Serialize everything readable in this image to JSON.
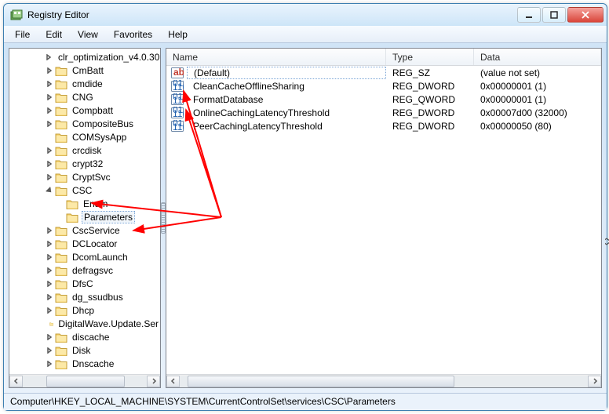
{
  "window": {
    "title": "Registry Editor"
  },
  "menu": {
    "file": "File",
    "edit": "Edit",
    "view": "View",
    "favorites": "Favorites",
    "help": "Help"
  },
  "tree": {
    "items": [
      {
        "label": "clr_optimization_v4.0.30",
        "depth": 3,
        "expandable": true
      },
      {
        "label": "CmBatt",
        "depth": 3,
        "expandable": true
      },
      {
        "label": "cmdide",
        "depth": 3,
        "expandable": true
      },
      {
        "label": "CNG",
        "depth": 3,
        "expandable": true
      },
      {
        "label": "Compbatt",
        "depth": 3,
        "expandable": true
      },
      {
        "label": "CompositeBus",
        "depth": 3,
        "expandable": true
      },
      {
        "label": "COMSysApp",
        "depth": 3,
        "expandable": false
      },
      {
        "label": "crcdisk",
        "depth": 3,
        "expandable": true
      },
      {
        "label": "crypt32",
        "depth": 3,
        "expandable": true
      },
      {
        "label": "CryptSvc",
        "depth": 3,
        "expandable": true
      },
      {
        "label": "CSC",
        "depth": 3,
        "expandable": true,
        "expanded": true
      },
      {
        "label": "Enum",
        "depth": 4,
        "expandable": false
      },
      {
        "label": "Parameters",
        "depth": 4,
        "expandable": false,
        "selected": true
      },
      {
        "label": "CscService",
        "depth": 3,
        "expandable": true
      },
      {
        "label": "DCLocator",
        "depth": 3,
        "expandable": true
      },
      {
        "label": "DcomLaunch",
        "depth": 3,
        "expandable": true
      },
      {
        "label": "defragsvc",
        "depth": 3,
        "expandable": true
      },
      {
        "label": "DfsC",
        "depth": 3,
        "expandable": true
      },
      {
        "label": "dg_ssudbus",
        "depth": 3,
        "expandable": true
      },
      {
        "label": "Dhcp",
        "depth": 3,
        "expandable": true
      },
      {
        "label": "DigitalWave.Update.Ser",
        "depth": 3,
        "expandable": false
      },
      {
        "label": "discache",
        "depth": 3,
        "expandable": true
      },
      {
        "label": "Disk",
        "depth": 3,
        "expandable": true
      },
      {
        "label": "Dnscache",
        "depth": 3,
        "expandable": true
      }
    ]
  },
  "list": {
    "columns": {
      "name": "Name",
      "type": "Type",
      "data": "Data"
    },
    "rows": [
      {
        "icon": "string",
        "name": "(Default)",
        "type": "REG_SZ",
        "data": "(value not set)",
        "selected": true
      },
      {
        "icon": "binary",
        "name": "CleanCacheOfflineSharing",
        "type": "REG_DWORD",
        "data": "0x00000001 (1)"
      },
      {
        "icon": "binary",
        "name": "FormatDatabase",
        "type": "REG_QWORD",
        "data": "0x00000001 (1)"
      },
      {
        "icon": "binary",
        "name": "OnlineCachingLatencyThreshold",
        "type": "REG_DWORD",
        "data": "0x00007d00 (32000)"
      },
      {
        "icon": "binary",
        "name": "PeerCachingLatencyThreshold",
        "type": "REG_DWORD",
        "data": "0x00000050 (80)"
      }
    ]
  },
  "statusbar": {
    "path": "Computer\\HKEY_LOCAL_MACHINE\\SYSTEM\\CurrentControlSet\\services\\CSC\\Parameters"
  }
}
